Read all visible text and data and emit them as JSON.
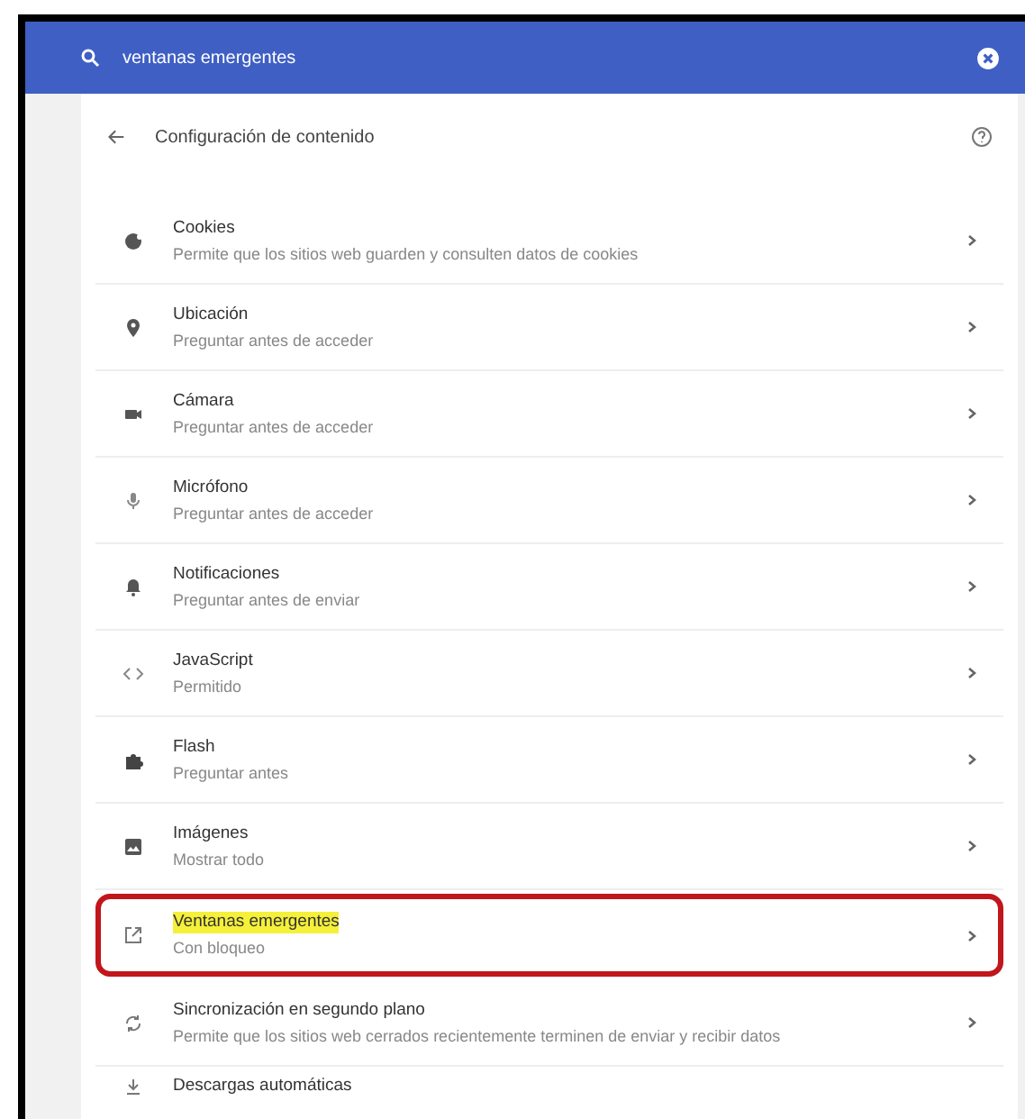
{
  "search": {
    "value": "ventanas emergentes"
  },
  "header": {
    "title": "Configuración de contenido"
  },
  "items": [
    {
      "kind": "cookie",
      "title": "Cookies",
      "subtitle": "Permite que los sitios web guarden y consulten datos de cookies",
      "highlighted": false
    },
    {
      "kind": "location",
      "title": "Ubicación",
      "subtitle": "Preguntar antes de acceder",
      "highlighted": false
    },
    {
      "kind": "camera",
      "title": "Cámara",
      "subtitle": "Preguntar antes de acceder",
      "highlighted": false
    },
    {
      "kind": "mic",
      "title": "Micrófono",
      "subtitle": "Preguntar antes de acceder",
      "highlighted": false
    },
    {
      "kind": "bell",
      "title": "Notificaciones",
      "subtitle": "Preguntar antes de enviar",
      "highlighted": false
    },
    {
      "kind": "code",
      "title": "JavaScript",
      "subtitle": "Permitido",
      "highlighted": false
    },
    {
      "kind": "puzzle",
      "title": "Flash",
      "subtitle": "Preguntar antes",
      "highlighted": false
    },
    {
      "kind": "image",
      "title": "Imágenes",
      "subtitle": "Mostrar todo",
      "highlighted": false
    },
    {
      "kind": "popup",
      "title": "Ventanas emergentes",
      "subtitle": "Con bloqueo",
      "highlighted": true
    },
    {
      "kind": "sync",
      "title": "Sincronización en segundo plano",
      "subtitle": "Permite que los sitios web cerrados recientemente terminen de enviar y recibir datos",
      "highlighted": false
    },
    {
      "kind": "download",
      "title": "Descargas automáticas",
      "highlighted": false
    }
  ]
}
